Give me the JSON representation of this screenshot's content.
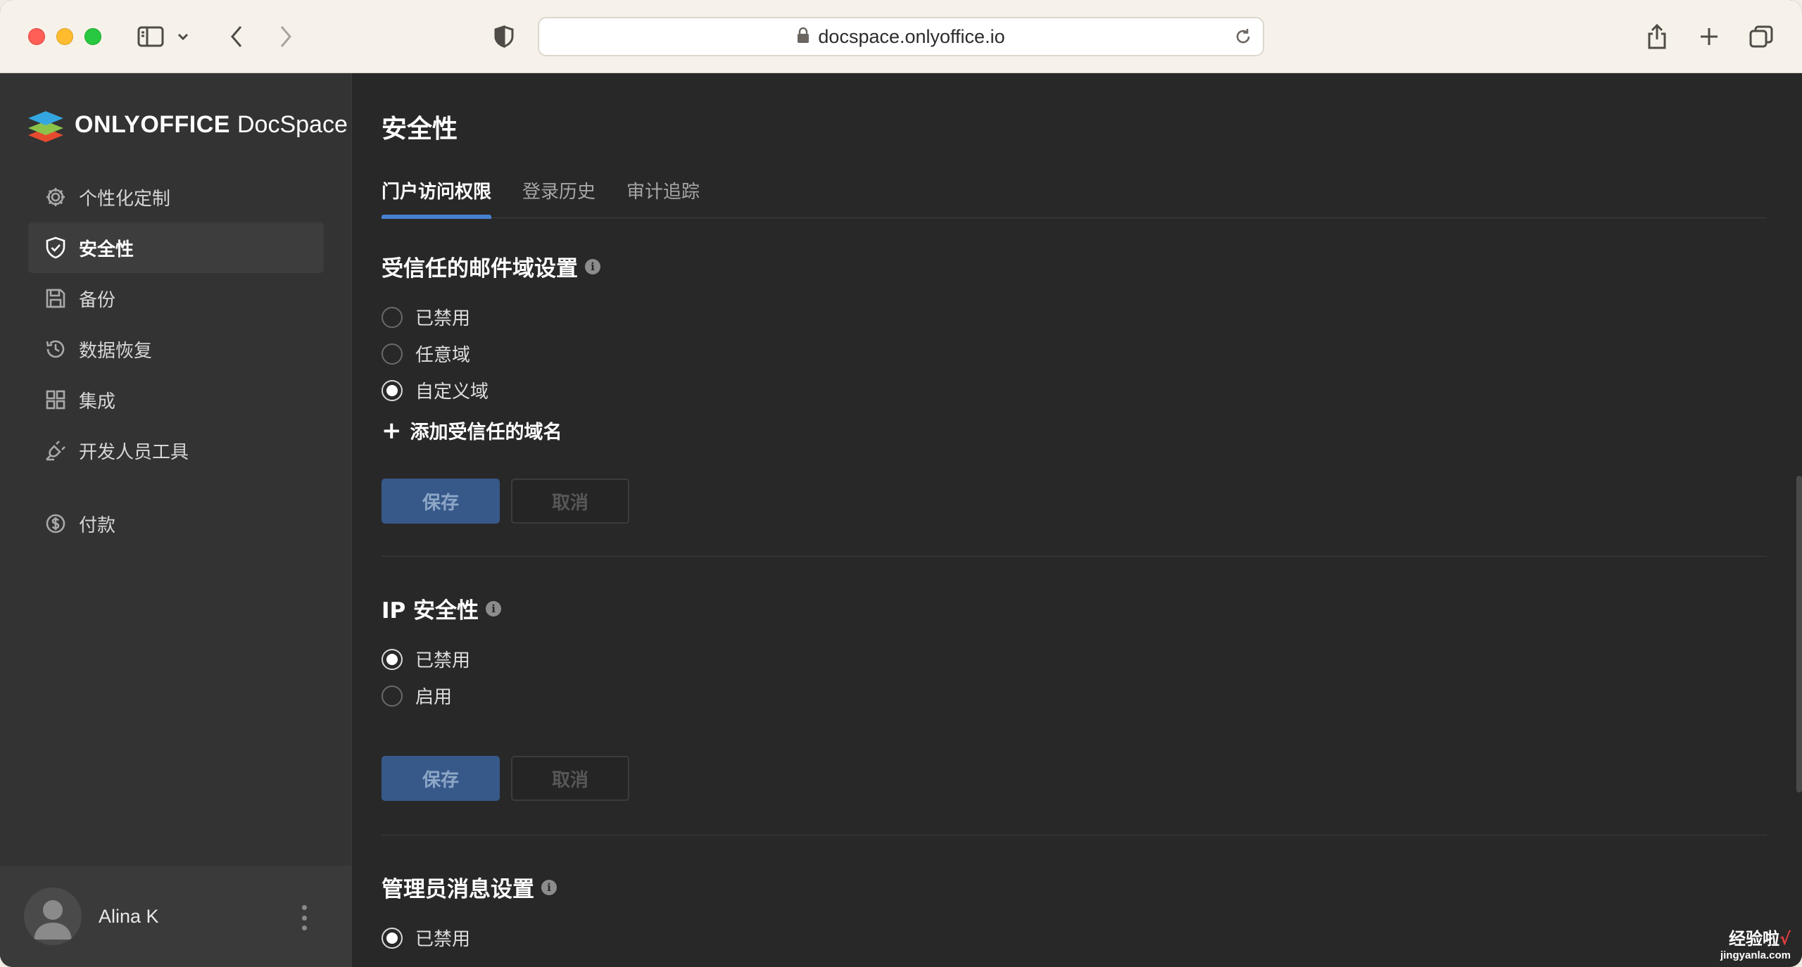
{
  "browser": {
    "url": "docspace.onlyoffice.io"
  },
  "sidebar": {
    "logo_brand": "ONLYOFFICE",
    "logo_product": "DocSpace",
    "items": [
      {
        "label": "个性化定制",
        "icon": "gear-icon"
      },
      {
        "label": "安全性",
        "icon": "shield-icon",
        "active": true
      },
      {
        "label": "备份",
        "icon": "floppy-icon"
      },
      {
        "label": "数据恢复",
        "icon": "history-icon"
      },
      {
        "label": "集成",
        "icon": "grid-icon"
      },
      {
        "label": "开发人员工具",
        "icon": "plug-icon"
      },
      {
        "label": "付款",
        "icon": "dollar-icon"
      }
    ],
    "user": {
      "name": "Alina K"
    }
  },
  "main": {
    "title": "安全性",
    "tabs": [
      {
        "label": "门户访问权限",
        "active": true
      },
      {
        "label": "登录历史"
      },
      {
        "label": "审计追踪"
      }
    ],
    "trusted_domains": {
      "title": "受信任的邮件域设置",
      "options": [
        {
          "label": "已禁用",
          "checked": false
        },
        {
          "label": "任意域",
          "checked": false
        },
        {
          "label": "自定义域",
          "checked": true
        }
      ],
      "add_label": "添加受信任的域名",
      "save_label": "保存",
      "cancel_label": "取消"
    },
    "ip_security": {
      "title": "IP 安全性",
      "options": [
        {
          "label": "已禁用",
          "checked": true
        },
        {
          "label": "启用",
          "checked": false
        }
      ],
      "save_label": "保存",
      "cancel_label": "取消"
    },
    "admin_messages": {
      "title": "管理员消息设置",
      "options": [
        {
          "label": "已禁用",
          "checked": true
        }
      ]
    }
  },
  "watermark": {
    "line1": "经验啦",
    "check": "√",
    "line2": "jingyanla.com"
  },
  "colors": {
    "accent": "#4781d1",
    "save_button": "#37598a",
    "sidebar_bg": "#333333",
    "main_bg": "#282828"
  }
}
